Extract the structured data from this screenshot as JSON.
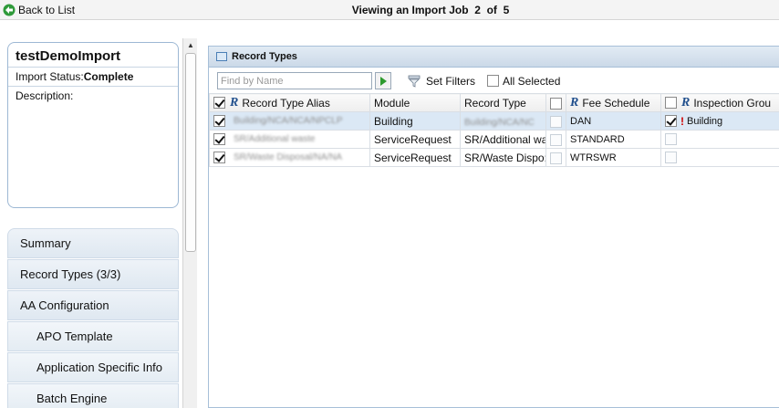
{
  "topbar": {
    "back_label": "Back to List",
    "viewing_prefix": "Viewing an Import Job",
    "current": "2",
    "of_label": "of",
    "total": "5"
  },
  "job": {
    "name": "testDemoImport",
    "status_label": "Import Status:",
    "status_value": "Complete",
    "description_label": "Description:"
  },
  "nav": {
    "items": [
      {
        "label": "Summary"
      },
      {
        "label": "Record Types (3/3)"
      },
      {
        "label": "AA Configuration"
      }
    ],
    "sub_items": [
      {
        "label": "APO Template"
      },
      {
        "label": "Application Specific Info"
      },
      {
        "label": "Batch Engine"
      }
    ]
  },
  "panel": {
    "title": "Record Types",
    "find_placeholder": "Find by Name",
    "set_filters_label": "Set Filters",
    "all_selected_label": "All Selected"
  },
  "table": {
    "headers": {
      "alias": "Record Type Alias",
      "module": "Module",
      "record_type": "Record Type",
      "fee_schedule": "Fee Schedule",
      "inspection_group": "Inspection Grou"
    },
    "rows": [
      {
        "alias": "Building/NCA/NCA/NPCLP",
        "module": "Building",
        "record_type": "Building/NCA/NC",
        "fee_schedule": "DAN",
        "inspection": "Building"
      },
      {
        "alias": "SR/Additional waste",
        "module": "ServiceRequest",
        "record_type": "SR/Additional wa",
        "fee_schedule": "STANDARD",
        "inspection": ""
      },
      {
        "alias": "SR/Waste Disposal/NA/NA",
        "module": "ServiceRequest",
        "record_type": "SR/Waste Dispo:",
        "fee_schedule": "WTRSWR",
        "inspection": ""
      }
    ]
  },
  "colors": {
    "accent": "#1f4e8c",
    "selected_row": "#dbe8f5",
    "panel_border": "#a7bfd8",
    "warning": "#d00000"
  }
}
